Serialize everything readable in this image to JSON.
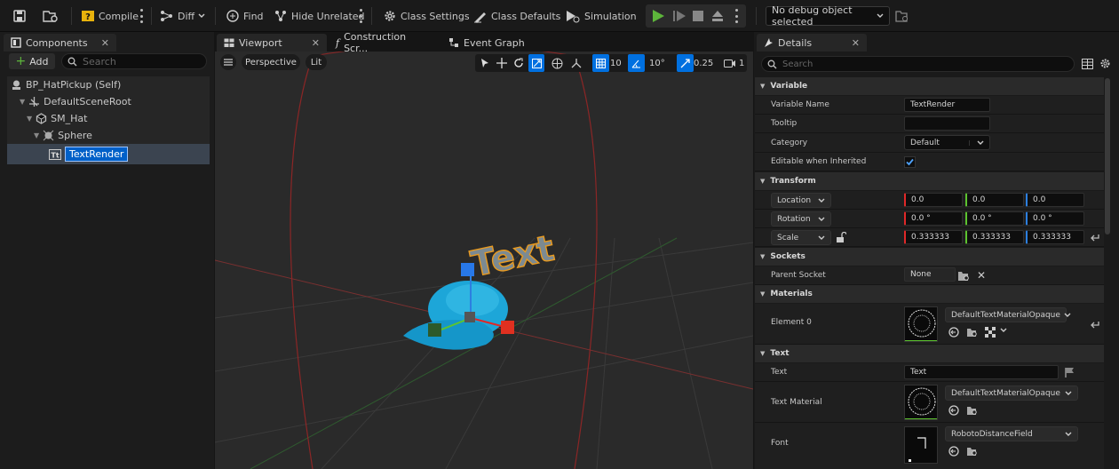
{
  "toolbar": {
    "compile": "Compile",
    "diff": "Diff",
    "find": "Find",
    "hide_unrelated": "Hide Unrelated",
    "class_settings": "Class Settings",
    "class_defaults": "Class Defaults",
    "simulation": "Simulation",
    "debug_object": "No debug object selected"
  },
  "components": {
    "tab_label": "Components",
    "add_label": "Add",
    "search_placeholder": "Search",
    "tree": [
      {
        "label": "BP_HatPickup (Self)",
        "icon": "blueprint-icon"
      },
      {
        "label": "DefaultSceneRoot",
        "icon": "scene-root-icon"
      },
      {
        "label": "SM_Hat",
        "icon": "static-mesh-icon"
      },
      {
        "label": "Sphere",
        "icon": "sphere-icon"
      },
      {
        "label": "TextRender",
        "icon": "text-render-icon",
        "selected": true
      }
    ]
  },
  "center_tabs": {
    "viewport": "Viewport",
    "construction": "Construction Scr...",
    "event_graph": "Event Graph"
  },
  "viewport": {
    "perspective": "Perspective",
    "lit": "Lit",
    "grid_snap": "10",
    "rot_snap": "10°",
    "scale_snap": "0.25",
    "camera_speed": "1",
    "text_actor": "Text"
  },
  "details": {
    "tab_label": "Details",
    "search_placeholder": "Search",
    "sections": {
      "variable": "Variable",
      "transform": "Transform",
      "sockets": "Sockets",
      "materials": "Materials",
      "text": "Text"
    },
    "variable": {
      "name_label": "Variable Name",
      "name_value": "TextRender",
      "tooltip_label": "Tooltip",
      "tooltip_value": "",
      "category_label": "Category",
      "category_value": "Default",
      "editable_label": "Editable when Inherited",
      "editable_checked": true
    },
    "transform": {
      "location_label": "Location",
      "rotation_label": "Rotation",
      "scale_label": "Scale",
      "location": [
        "0.0",
        "0.0",
        "0.0"
      ],
      "rotation": [
        "0.0 °",
        "0.0 °",
        "0.0 °"
      ],
      "scale": [
        "0.333333",
        "0.333333",
        "0.333333"
      ]
    },
    "sockets": {
      "parent_label": "Parent Socket",
      "parent_value": "None"
    },
    "materials": {
      "element0_label": "Element 0",
      "element0_value": "DefaultTextMaterialOpaque"
    },
    "text": {
      "text_label": "Text",
      "text_value": "Text",
      "material_label": "Text Material",
      "material_value": "DefaultTextMaterialOpaque",
      "font_label": "Font",
      "font_value": "RobotoDistanceField"
    }
  },
  "colors": {
    "accent_blue": "#0070e0",
    "play_green": "#5db53b",
    "x_axis": "#e02828",
    "y_axis": "#5dc42f",
    "z_axis": "#2c7fe0"
  }
}
